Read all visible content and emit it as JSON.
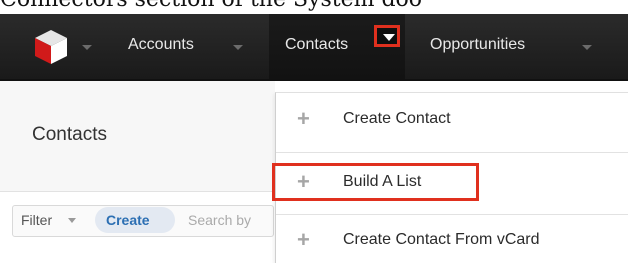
{
  "document": {
    "caption": "Connectors section of the System doo"
  },
  "navbar": {
    "items": [
      {
        "label": "Accounts"
      },
      {
        "label": "Contacts"
      },
      {
        "label": "Opportunities"
      }
    ],
    "active": "Contacts"
  },
  "page": {
    "title": "Contacts"
  },
  "filter": {
    "label": "Filter",
    "create_label": "Create",
    "search_text": "Search by"
  },
  "menu": {
    "items": [
      {
        "label": "Create Contact",
        "icon": "plus-icon"
      },
      {
        "label": "Build A List",
        "icon": "plus-icon",
        "highlighted": true
      },
      {
        "label": "Create Contact From vCard",
        "icon": "plus-icon"
      }
    ]
  },
  "colors": {
    "navbar": "#1e1e1e",
    "highlight": "#e0301e",
    "link": "#2c6fb3"
  }
}
